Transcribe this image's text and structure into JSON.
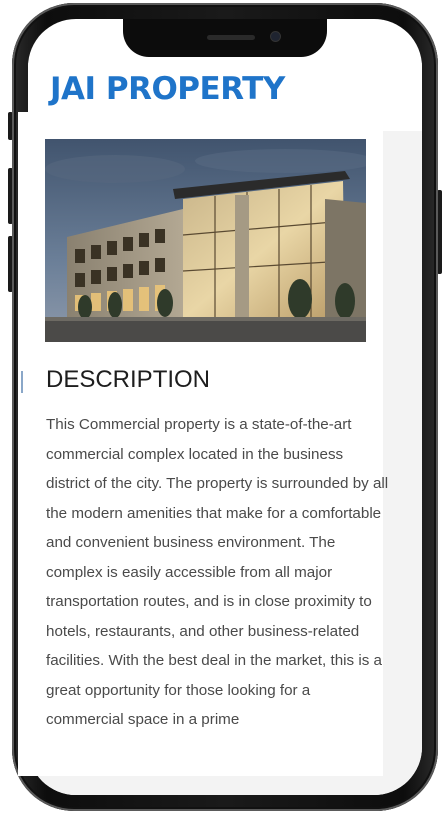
{
  "app": {
    "title": "JAI PROPERTY"
  },
  "listing": {
    "image_alt": "Modern multi-storey commercial building with glass facade at dusk",
    "section_heading": "DESCRIPTION",
    "description": "This Commercial property is a state-of-the-art commercial complex located in the business district of the city. The property is surrounded by all the modern amenities that make for a comfortable and convenient business environment. The complex is easily accessible from all major transportation routes, and is in close proximity to hotels, restaurants, and other business-related facilities. With the best deal in the market, this is a great opportunity for those looking for a commercial space in a prime"
  },
  "colors": {
    "brand": "#1f74c9",
    "heading": "#1e1e1e",
    "body_text": "#4a4a4a",
    "phone_frame": "#1a1a1a"
  }
}
